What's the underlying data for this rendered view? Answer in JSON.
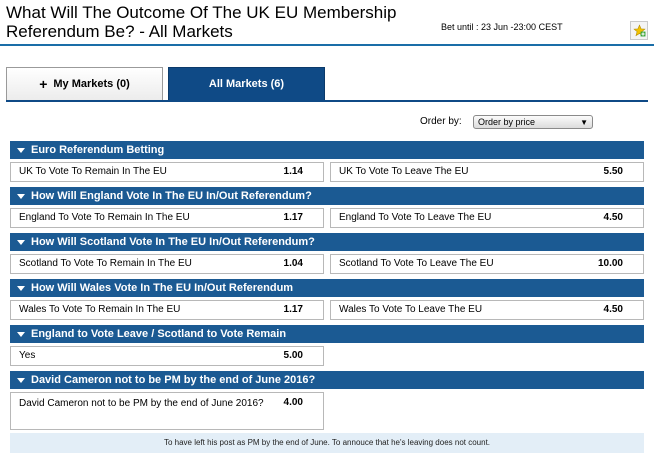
{
  "header": {
    "title": "What Will The Outcome Of The UK EU Membership Referendum Be? - All Markets",
    "bet_until": "Bet until : 23 Jun -23:00 CEST"
  },
  "tabs": {
    "my_markets": "My Markets (0)",
    "all_markets": "All Markets (6)"
  },
  "order": {
    "label": "Order by:",
    "selected": "Order by price"
  },
  "markets": [
    {
      "title": "Euro Referendum Betting",
      "selections": [
        {
          "name": "UK To Vote To Remain In The EU",
          "odds": "1.14"
        },
        {
          "name": "UK To Vote To Leave The EU",
          "odds": "5.50"
        }
      ]
    },
    {
      "title": "How Will England Vote In The EU In/Out Referendum?",
      "selections": [
        {
          "name": "England To Vote To Remain In The EU",
          "odds": "1.17"
        },
        {
          "name": "England To Vote To Leave The EU",
          "odds": "4.50"
        }
      ]
    },
    {
      "title": "How Will Scotland Vote In The EU In/Out Referendum?",
      "selections": [
        {
          "name": "Scotland To Vote To Remain In The EU",
          "odds": "1.04"
        },
        {
          "name": "Scotland To Vote To Leave The EU",
          "odds": "10.00"
        }
      ]
    },
    {
      "title": "How Will Wales Vote In The EU In/Out Referendum",
      "selections": [
        {
          "name": "Wales To Vote To Remain In The EU",
          "odds": "1.17"
        },
        {
          "name": "Wales To Vote To Leave The EU",
          "odds": "4.50"
        }
      ]
    },
    {
      "title": "England to Vote Leave / Scotland to Vote Remain",
      "selections": [
        {
          "name": "Yes",
          "odds": "5.00"
        }
      ]
    },
    {
      "title": "David Cameron not to be PM by the end of June 2016?",
      "selections": [
        {
          "name": "David Cameron not to be PM by the end of June 2016?",
          "odds": "4.00"
        }
      ],
      "note": "To have left his post as PM by the end of June. To annouce that he's leaving does not count."
    }
  ],
  "icons": {
    "favourite": "star-icon",
    "expand": "triangle-down-icon",
    "add": "plus-icon"
  },
  "colors": {
    "accent": "#1b5a93",
    "tab_active": "#0f4a86",
    "note_bg": "#e3eef7"
  }
}
